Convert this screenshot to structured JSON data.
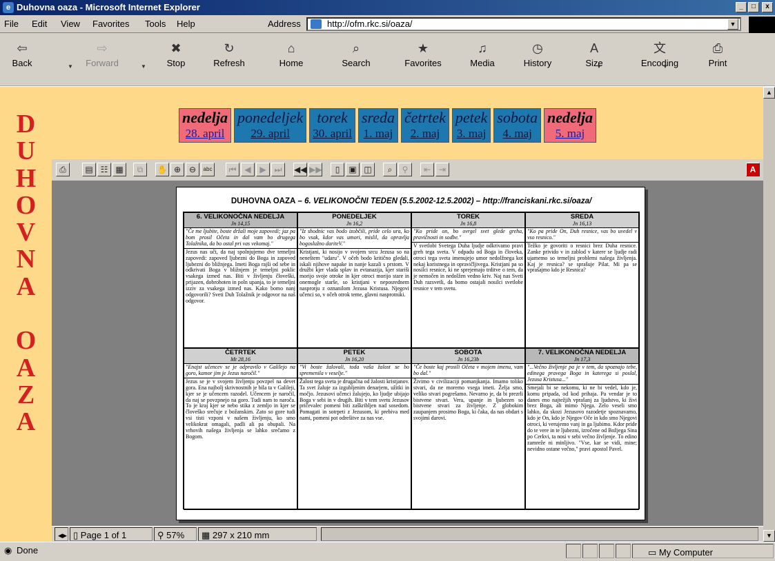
{
  "window": {
    "title": "Duhovna oaza - Microsoft Internet Explorer",
    "buttons": [
      "_",
      "□",
      "x"
    ]
  },
  "menu": [
    "File",
    "Edit",
    "View",
    "Favorites",
    "Tools",
    "Help"
  ],
  "address": {
    "label": "Address",
    "url": "http://ofm.rkc.si/oaza/"
  },
  "toolbar": [
    {
      "label": "Back",
      "icon": "back-icon",
      "glyph": "⇦",
      "enabled": true
    },
    {
      "label": "Forward",
      "icon": "forward-icon",
      "glyph": "⇨",
      "enabled": false
    },
    {
      "label": "Stop",
      "icon": "stop-icon",
      "glyph": "✖",
      "enabled": true
    },
    {
      "label": "Refresh",
      "icon": "refresh-icon",
      "glyph": "↻",
      "enabled": true
    },
    {
      "label": "Home",
      "icon": "home-icon",
      "glyph": "⌂",
      "enabled": true
    },
    {
      "label": "Search",
      "icon": "search-icon",
      "glyph": "⌕",
      "enabled": true
    },
    {
      "label": "Favorites",
      "icon": "favorites-icon",
      "glyph": "★",
      "enabled": true
    },
    {
      "label": "Media",
      "icon": "media-icon",
      "glyph": "♫",
      "enabled": true
    },
    {
      "label": "History",
      "icon": "history-icon",
      "glyph": "◷",
      "enabled": true
    },
    {
      "label": "Size",
      "icon": "size-icon",
      "glyph": "A",
      "enabled": true
    },
    {
      "label": "Encoding",
      "icon": "encoding-icon",
      "glyph": "文",
      "enabled": true
    },
    {
      "label": "Print",
      "icon": "print-icon",
      "glyph": "⎙",
      "enabled": true
    }
  ],
  "side_letters": [
    "D",
    "U",
    "H",
    "O",
    "V",
    "N",
    "A",
    "",
    "O",
    "A",
    "Z",
    "A"
  ],
  "days": [
    {
      "name": "nedelja",
      "date": "28. april",
      "sunday": true
    },
    {
      "name": "ponedeljek",
      "date": "29. april",
      "sunday": false
    },
    {
      "name": "torek",
      "date": "30. april",
      "sunday": false
    },
    {
      "name": "sreda",
      "date": "1. maj",
      "sunday": false
    },
    {
      "name": "četrtek",
      "date": "2. maj",
      "sunday": false
    },
    {
      "name": "petek",
      "date": "3. maj",
      "sunday": false
    },
    {
      "name": "sobota",
      "date": "4. maj",
      "sunday": false
    },
    {
      "name": "nedelja",
      "date": "5. maj",
      "sunday": true
    }
  ],
  "pdf": {
    "title_prefix": "DUHOVNA OAZA",
    "title_rest": " – 6. VELIKONOČNI TEDEN (5.5.2002-12.5.2002) – http://franciskani.rkc.si/oaza/",
    "page_label": "Page 1 of 1",
    "zoom": "57%",
    "size": "297 x 210 mm",
    "cells": [
      {
        "title": "6. VELIKONOČNA NEDELJA",
        "ref": "Jn 14,15",
        "quote": "\"Če me ljubite, boste držali moje zapovedi; jaz pa bom prosil Očeta in dal vam bo drugega Tolažnika, da bo ostal pri vas vekomaj.\"",
        "body": "Jezus nas uči, da naj spolnjujemo dve temeljni zapovedi: zapoved ljubezni do Boga in zapoved ljubezni do bližnjega. Imeti Boga rajši od sebe in odkrivati Boga v bližnjem je temeljni poklic vsakega izmed nas. Biti v življenju človeški, prijazen, dobrohoten in poln upanja, to je temeljni izziv za vsakega izmed nas. Kako bomo nanj odgovorili? Sveti Duh Tolažnik je odgovor na naš odgovor."
      },
      {
        "title": "PONEDELJEK",
        "ref": "Jn 16,2",
        "quote": "\"Iz shodnic vas bodo izobčili, pride celo ura, ko bo vsak, kdor vas umori, mislil, da opravlja bogoslužno dariteV.\"",
        "body": "Kristjani, ki nosijo v svojem srcu Jezusa so na neneštem \"udaru\". V očeh bodo kritično gledali, iskali njihove napake in nanje kazali s prstom. V družbi kjer vlada splav in evtanazija, kjer stariši morijo svoje otroke in kjer otroci morijo stare in onemogle starše, so kristjani v neposrednem nasprotju z oznanilom Jezusa Kristusa. Njegovi učenci so, v očeh otrok teme, glavni nasprotniki."
      },
      {
        "title": "TOREK",
        "ref": "Jn 16,8",
        "quote": "\"Ko pride on, bo ovrgel svet glede greha, pravičnosti in sodbe.\"",
        "body": "V svetlobi Svetega Duha ljudje odkrivamo pravi greh tega sveta. V odpadu od Boga in človeka, otroci tega sveta imenujejo umor nedolžnega kot nekaj koristnega in opravičljivega. Kristjani pa so nosilci resnice, ki ne sprejemajo trditve o tem, da je nemočen in nedolžen vedno kriv. Naj nas Sveti Duh razsvetli, da bomo ostajali nosilci svetlobe resnice v tem svetu."
      },
      {
        "title": "SREDA",
        "ref": "Jn 16,13",
        "quote": "\"Ko pa pride On, Duh resnice, vas bo uvedel v vso resnico.\"",
        "body": "Težko je govoriti o resnici brez Duha resnice. Zanke privido v in zablod v katere se ljudje radi ujamemo so temeljni problemi našega življenja. Kaj je resnica? se sprašuje Pilat. Mi pa se vprašajmo kdo je Resnica?"
      },
      {
        "title": "ČETRTEK",
        "ref": "Mt 28,16",
        "quote": "\"Enajst učencev se je odpravilo v Galilejo na goro, kamor jim je Jezus naročil.\"",
        "body": "Jezus se je v svojem življenju povzpel na devet gora. Ena najbolj skrivnostnih je bila ta v Galileji, kjer se je učencem razodel. Učencem je naročil, da naj se povzpnejo na goro. Tudi nam to naroča. To je kraj kjer se nebo stika z zemljo in kjer se človeško srečuje z božanskim. Zato so gore tudi vsi tisti vzponi v našem življenju, ko smo velikokrat omagali, padli ali pa obupali. Na vrhovih našega življenja se lahko srečamo z Bogom."
      },
      {
        "title": "PETEK",
        "ref": "Jn 16,20",
        "quote": "\"Vi boste žalovali, toda vaša žalost se bo spremenila v veselje.\"",
        "body": "Žalost tega sveta je drugačna od žalosti kristjanov. Ta svet žaluje za izgubljenim denarjem, užitki in močjo. Jezusovi učenci žalujejo, ko ljudje ubijajo Boga v sebi in v drugih. Biti v tem svetu Jezusov pričevalec pomeni biti zaškribljen nad sosedom. Pomagati in sotrpeti z Jezusom, ki prebiva med nami, pomeni pot odrešitve za nas vse."
      },
      {
        "title": "SOBOTA",
        "ref": "Jn 16,23b",
        "quote": "\"Če boste kaj prosili Očeta v mojem imenu, vam bo dal.\"",
        "body": "Živimo v civilizaciji pomanjkanja. Imamo toliko stvari, da ne moremo vsega imeti. Želja smo, veliko stvari pogrešamo. Nevarno je, da bi prezrli bistvene stvari. Vera, upanje in ljubezen so bistvene stvari za življenje. Z globokim zaupanjem prosimo Boga, ki čaka, da nas obdari s svojimi darovi."
      },
      {
        "title": "7. VELIKONOČNA NEDELJA",
        "ref": "Jn 17,3",
        "quote": "\"...Večno življenje pa je v tem, da spoznajo tebe, edinega pravega Boga in katerega si poslal, Jezusa Kristusa...\"",
        "body": "Smejali bi se nekomu, ki ne bi vedel, kdo je, komu pripada, od kod prihaja. Pa vendar je to danes eno najtežjih vprašanj za ljudstvo, ki živi brez Boga, ali mimo Njega. Zelo veseli smo lahko, da skozi Jezusovo razodetje spoznavamo, kdo je On, kdo je Njegov Oče in kdo smo Njegovi otroci, ki verujemo vanj in ga ljubimo. Kdor pride do te vere in te ljubezni, izročene od Božjega Sina po Cerkvi, ta nosi v sebi večno življenje. To edino zamreže ni minljivo. \"Vse, kar se vidi, mine; nevidno ostane večno,\" pravi apostol Pavel."
      }
    ]
  },
  "status": {
    "left": "Done",
    "right": "My Computer"
  },
  "colors": {
    "titlebar": "#0a246a",
    "page_bg": "#ffd98a",
    "side_letters": "#d42020",
    "weekday_bg": "#1e78b0",
    "sunday_bg": "#f06a7a"
  }
}
